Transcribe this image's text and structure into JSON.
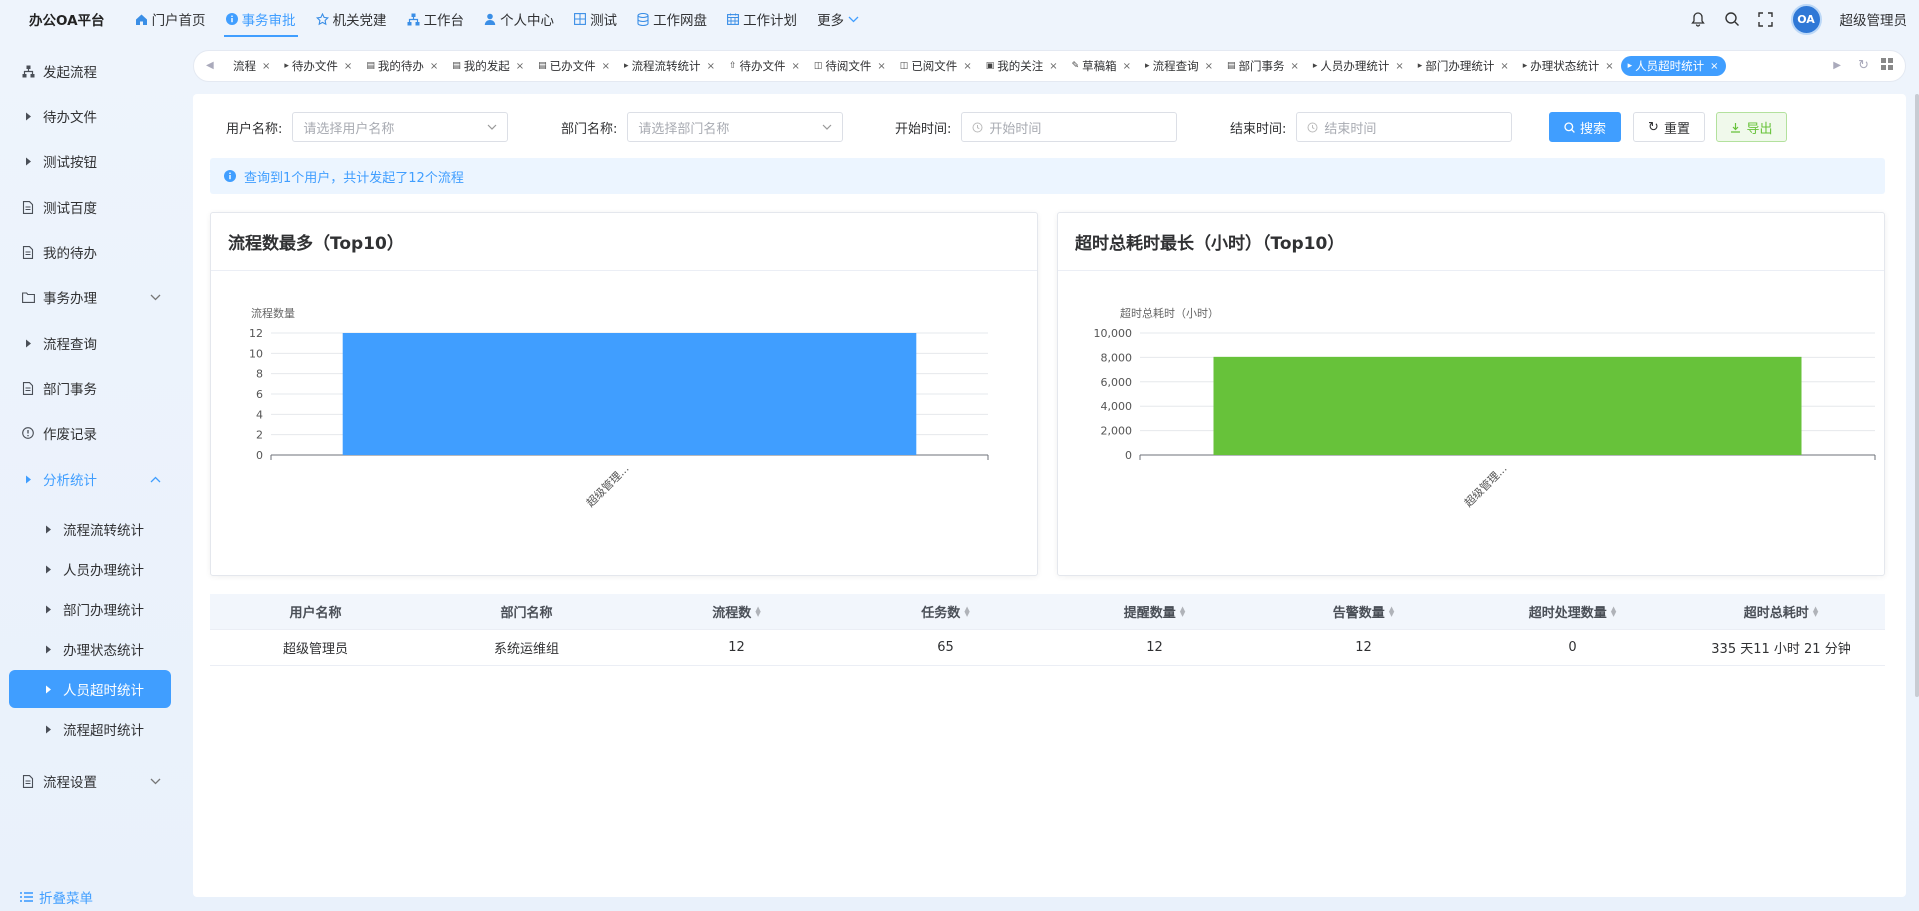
{
  "app": {
    "title": "办公OA平台"
  },
  "topnav": [
    {
      "label": "门户首页",
      "icon": "home-icon"
    },
    {
      "label": "事务审批",
      "icon": "info-icon",
      "active": true
    },
    {
      "label": "机关党建",
      "icon": "star-icon"
    },
    {
      "label": "工作台",
      "icon": "sitemap-icon"
    },
    {
      "label": "个人中心",
      "icon": "user-icon"
    },
    {
      "label": "测试",
      "icon": "grid-icon"
    },
    {
      "label": "工作网盘",
      "icon": "database-icon"
    },
    {
      "label": "工作计划",
      "icon": "calendar-icon"
    },
    {
      "label": "更多",
      "icon": "chevron-down-icon"
    }
  ],
  "user": {
    "name": "超级管理员",
    "avatar_text": "OA"
  },
  "sidebar": {
    "items": [
      {
        "label": "发起流程",
        "icon": "sitemap-icon"
      },
      {
        "label": "待办文件",
        "icon": "caret-right-icon"
      },
      {
        "label": "测试按钮",
        "icon": "caret-right-icon"
      },
      {
        "label": "测试百度",
        "icon": "document-icon"
      },
      {
        "label": "我的待办",
        "icon": "document-icon"
      },
      {
        "label": "事务办理",
        "icon": "folder-icon",
        "chevron": "down"
      },
      {
        "label": "流程查询",
        "icon": "caret-right-icon"
      },
      {
        "label": "部门事务",
        "icon": "document-icon"
      },
      {
        "label": "作废记录",
        "icon": "alert-circle-icon"
      },
      {
        "label": "分析统计",
        "icon": "caret-right-icon",
        "chevron": "up",
        "open": true
      },
      {
        "label": "流程流转统计",
        "icon": "caret-right-icon",
        "sub": true
      },
      {
        "label": "人员办理统计",
        "icon": "caret-right-icon",
        "sub": true
      },
      {
        "label": "部门办理统计",
        "icon": "caret-right-icon",
        "sub": true
      },
      {
        "label": "办理状态统计",
        "icon": "caret-right-icon",
        "sub": true
      },
      {
        "label": "人员超时统计",
        "icon": "caret-right-icon",
        "sub": true,
        "active": true
      },
      {
        "label": "流程超时统计",
        "icon": "caret-right-icon",
        "sub": true
      },
      {
        "label": "流程设置",
        "icon": "document-icon",
        "chevron": "down"
      }
    ],
    "collapse_label": "折叠菜单"
  },
  "tabs": [
    {
      "label": "流程",
      "icon": ""
    },
    {
      "label": "待办文件",
      "icon": "▸"
    },
    {
      "label": "我的待办",
      "icon": "▤"
    },
    {
      "label": "我的发起",
      "icon": "▤"
    },
    {
      "label": "已办文件",
      "icon": "▤"
    },
    {
      "label": "流程流转统计",
      "icon": "▸"
    },
    {
      "label": "待办文件",
      "icon": "⇧"
    },
    {
      "label": "待阅文件",
      "icon": "◫"
    },
    {
      "label": "已阅文件",
      "icon": "◫"
    },
    {
      "label": "我的关注",
      "icon": "▣"
    },
    {
      "label": "草稿箱",
      "icon": "✎"
    },
    {
      "label": "流程查询",
      "icon": "▸"
    },
    {
      "label": "部门事务",
      "icon": "▤"
    },
    {
      "label": "人员办理统计",
      "icon": "▸"
    },
    {
      "label": "部门办理统计",
      "icon": "▸"
    },
    {
      "label": "办理状态统计",
      "icon": "▸"
    },
    {
      "label": "人员超时统计",
      "icon": "▸",
      "active": true
    }
  ],
  "filters": {
    "user": {
      "label": "用户名称:",
      "placeholder": "请选择用户名称"
    },
    "dept": {
      "label": "部门名称:",
      "placeholder": "请选择部门名称"
    },
    "start": {
      "label": "开始时间:",
      "placeholder": "开始时间"
    },
    "end": {
      "label": "结束时间:",
      "placeholder": "结束时间"
    }
  },
  "buttons": {
    "search": "搜索",
    "reset": "重置",
    "export": "导出"
  },
  "info": "查询到1个用户，共计发起了12个流程",
  "charts": {
    "left_title": "流程数最多（Top10）",
    "right_title": "超时总耗时最长（小时）（Top10）"
  },
  "chart_data": [
    {
      "type": "bar",
      "title": "流程数最多（Top10）",
      "ylabel": "流程数量",
      "categories": [
        "超级管理..."
      ],
      "values": [
        12
      ],
      "ylim": [
        0,
        12
      ],
      "yticks": [
        "0",
        "2",
        "4",
        "6",
        "8",
        "10",
        "12"
      ],
      "color": "#409eff",
      "grid": true
    },
    {
      "type": "bar",
      "title": "超时总耗时最长（小时）（Top10）",
      "ylabel": "超时总耗时（小时）",
      "categories": [
        "超级管理..."
      ],
      "values": [
        8045
      ],
      "ylim": [
        0,
        10000
      ],
      "yticks": [
        "0",
        "2,000",
        "4,000",
        "6,000",
        "8,000",
        "10,000"
      ],
      "color": "#67c23a",
      "grid": true
    }
  ],
  "table": {
    "columns": [
      {
        "label": "用户名称",
        "sortable": false
      },
      {
        "label": "部门名称",
        "sortable": false
      },
      {
        "label": "流程数",
        "sortable": true
      },
      {
        "label": "任务数",
        "sortable": true
      },
      {
        "label": "提醒数量",
        "sortable": true
      },
      {
        "label": "告警数量",
        "sortable": true
      },
      {
        "label": "超时处理数量",
        "sortable": true
      },
      {
        "label": "超时总耗时",
        "sortable": true
      }
    ],
    "rows": [
      [
        "超级管理员",
        "系统运维组",
        "12",
        "65",
        "12",
        "12",
        "0",
        "335 天11 小时 21 分钟"
      ]
    ]
  }
}
